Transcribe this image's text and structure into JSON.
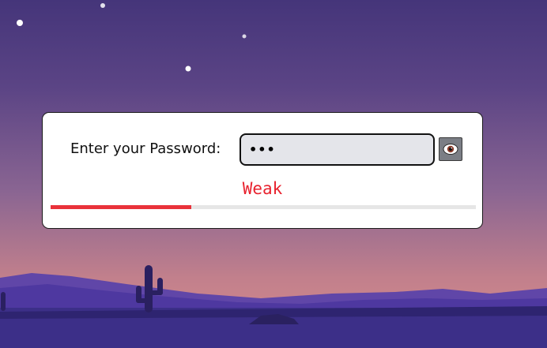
{
  "form": {
    "password_label": "Enter your Password:",
    "password_value": "•••",
    "toggle_icon": "eye-icon"
  },
  "strength": {
    "label": "Weak",
    "level": 0.33,
    "color": "#e9323a"
  },
  "colors": {
    "sky_top": "#45357a",
    "sky_mid": "#7a5a8e",
    "sky_horizon": "#d2888b",
    "ground": "#3c2f88",
    "accent_red": "#e8222e"
  }
}
